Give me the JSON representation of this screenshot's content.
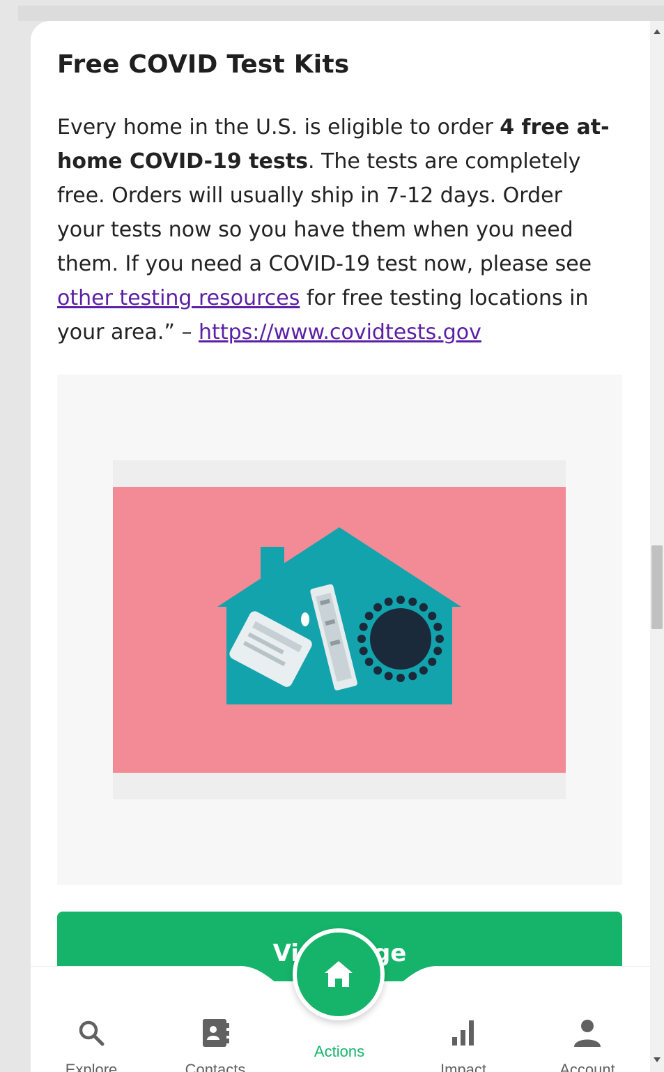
{
  "article": {
    "title": "Free COVID Test Kits",
    "p1": "Every home in the U.S. is eligible to order ",
    "bold1": "4 free at-home COVID-19 tests",
    "p2": ". The tests are completely free. Orders will usually ship in 7-12 days. Order your tests now so you have them when you need them. If you need a COVID-19 test now, please see ",
    "link1": "other testing resources",
    "p3": " for free testing locations in your area.” – ",
    "link2": "https://www.covidtests.gov"
  },
  "button": {
    "label": "Visit Page"
  },
  "nav": {
    "items": [
      {
        "label": "Explore",
        "icon": "search-icon"
      },
      {
        "label": "Contacts",
        "icon": "contacts-icon"
      },
      {
        "label": "Actions",
        "icon": "home-icon",
        "active": true
      },
      {
        "label": "Impact",
        "icon": "bar-chart-icon"
      },
      {
        "label": "Account",
        "icon": "person-icon"
      }
    ]
  },
  "colors": {
    "accent": "#15b46a",
    "link": "#5b1fa6",
    "image_bg": "#f38b97",
    "house": "#12a3ad"
  }
}
